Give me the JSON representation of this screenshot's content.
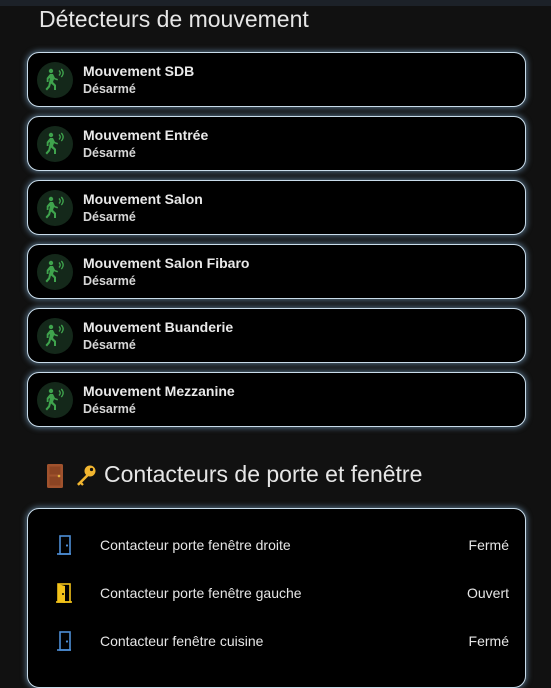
{
  "motion_section": {
    "title": "Détecteurs de mouvement",
    "sensors": [
      {
        "name": "Mouvement SDB",
        "state": "Désarmé"
      },
      {
        "name": "Mouvement Entrée",
        "state": "Désarmé"
      },
      {
        "name": "Mouvement Salon",
        "state": "Désarmé"
      },
      {
        "name": "Mouvement Salon Fibaro",
        "state": "Désarmé"
      },
      {
        "name": "Mouvement Buanderie",
        "state": "Désarmé"
      },
      {
        "name": "Mouvement Mezzanine",
        "state": "Désarmé"
      }
    ],
    "icon": "motion-sensor-icon",
    "icon_color": "#3fa34d"
  },
  "contact_section": {
    "title": "Contacteurs de porte et fenêtre",
    "title_icons": [
      "door-emoji-icon",
      "key-emoji-icon"
    ],
    "contacts": [
      {
        "name": "Contacteur porte fenêtre droite",
        "state": "Fermé",
        "icon": "door-closed-icon",
        "icon_color": "#4d8ed6"
      },
      {
        "name": "Contacteur porte fenêtre gauche",
        "state": "Ouvert",
        "icon": "door-open-icon",
        "icon_color": "#f2c21a"
      },
      {
        "name": "Contacteur fenêtre cuisine",
        "state": "Fermé",
        "icon": "door-closed-icon",
        "icon_color": "#4d8ed6"
      }
    ]
  }
}
